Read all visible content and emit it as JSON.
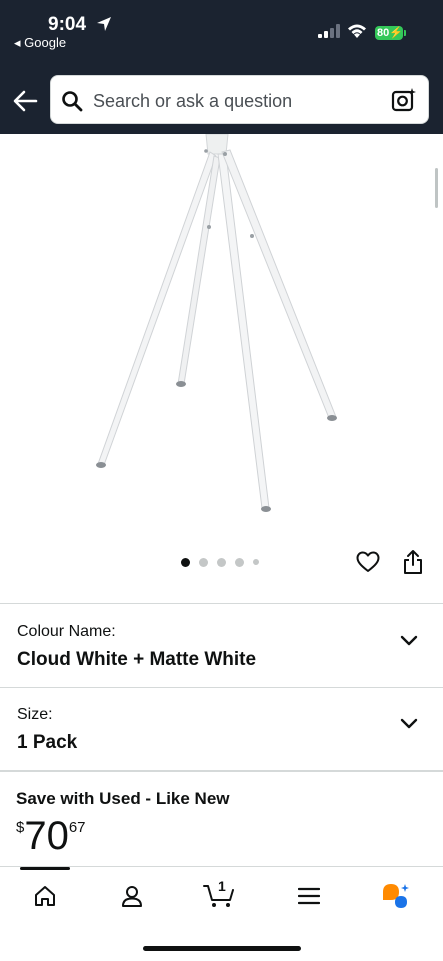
{
  "status": {
    "time": "9:04",
    "back_app": "◂ Google",
    "battery": "80"
  },
  "search": {
    "placeholder": "Search or ask a question"
  },
  "gallery": {
    "dots": 5,
    "active_index": 0
  },
  "variants": [
    {
      "label": "Colour Name:",
      "value": "Cloud White + Matte White"
    },
    {
      "label": "Size:",
      "value": "1 Pack"
    }
  ],
  "offer": {
    "title": "Save with Used - Like New",
    "currency": "$",
    "price_whole": "70",
    "price_fraction": "67"
  },
  "nav": {
    "cart_count": "1",
    "items": [
      "home-icon",
      "account-icon",
      "cart-icon",
      "menu-icon",
      "rufus-icon"
    ]
  },
  "colors": {
    "header_bg": "#1b2330",
    "battery": "#34c759",
    "rufus_orange": "#ff8a00",
    "rufus_blue": "#1a73e8"
  }
}
